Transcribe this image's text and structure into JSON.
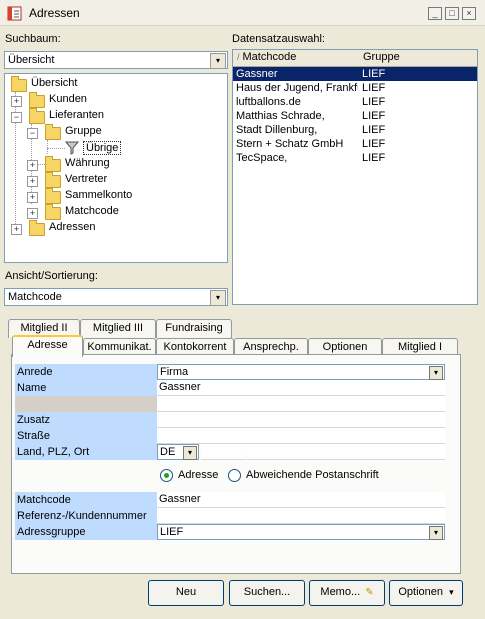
{
  "window": {
    "title": "Adressen",
    "minimize": "_",
    "restore": "□",
    "close": "×"
  },
  "left": {
    "suchbaum_label": "Suchbaum:",
    "suchbaum_value": "Übersicht",
    "tree": {
      "root": "Übersicht",
      "kunden": "Kunden",
      "lieferanten": "Lieferanten",
      "gruppe": "Gruppe",
      "uebrige": "Übrige",
      "waehrung": "Währung",
      "vertreter": "Vertreter",
      "sammelkonto": "Sammelkonto",
      "matchcode": "Matchcode",
      "adressen": "Adressen"
    },
    "ansicht_label": "Ansicht/Sortierung:",
    "ansicht_value": "Matchcode"
  },
  "right": {
    "label": "Datensatzauswahl:",
    "columns": [
      "Matchcode",
      "Gruppe"
    ],
    "rows": [
      [
        "Gassner",
        "LIEF"
      ],
      [
        "Haus der Jugend, Frankfurt",
        "LIEF"
      ],
      [
        "luftballons.de",
        "LIEF"
      ],
      [
        "Matthias Schrade,",
        "LIEF"
      ],
      [
        "Stadt Dillenburg,",
        "LIEF"
      ],
      [
        "Stern + Schatz GmbH",
        "LIEF"
      ],
      [
        "TecSpace,",
        "LIEF"
      ]
    ]
  },
  "tabs_top": [
    "Mitglied II",
    "Mitglied III",
    "Fundraising"
  ],
  "tabs_bottom": [
    "Adresse",
    "Kommunikat.",
    "Kontokorrent",
    "Ansprechp.",
    "Optionen",
    "Mitglied I"
  ],
  "form": {
    "anrede_label": "Anrede",
    "anrede_value": "Firma",
    "name_label": "Name",
    "name_value": "Gassner",
    "zusatz_label": "Zusatz",
    "strasse_label": "Straße",
    "ort_label": "Land, PLZ, Ort",
    "land_value": "DE",
    "radio_adresse": "Adresse",
    "radio_abweichend": "Abweichende Postanschrift",
    "matchcode_label": "Matchcode",
    "matchcode_value": "Gassner",
    "referenz_label": "Referenz-/Kundennummer",
    "gruppe_label": "Adressgruppe",
    "gruppe_value": "LIEF"
  },
  "buttons": {
    "neu": "Neu",
    "suchen": "Suchen...",
    "memo": "Memo...",
    "optionen": "Optionen"
  },
  "icons": {
    "dropdown": "▾",
    "plus": "+",
    "minus": "−",
    "sort": "/",
    "pencil": "✎"
  }
}
